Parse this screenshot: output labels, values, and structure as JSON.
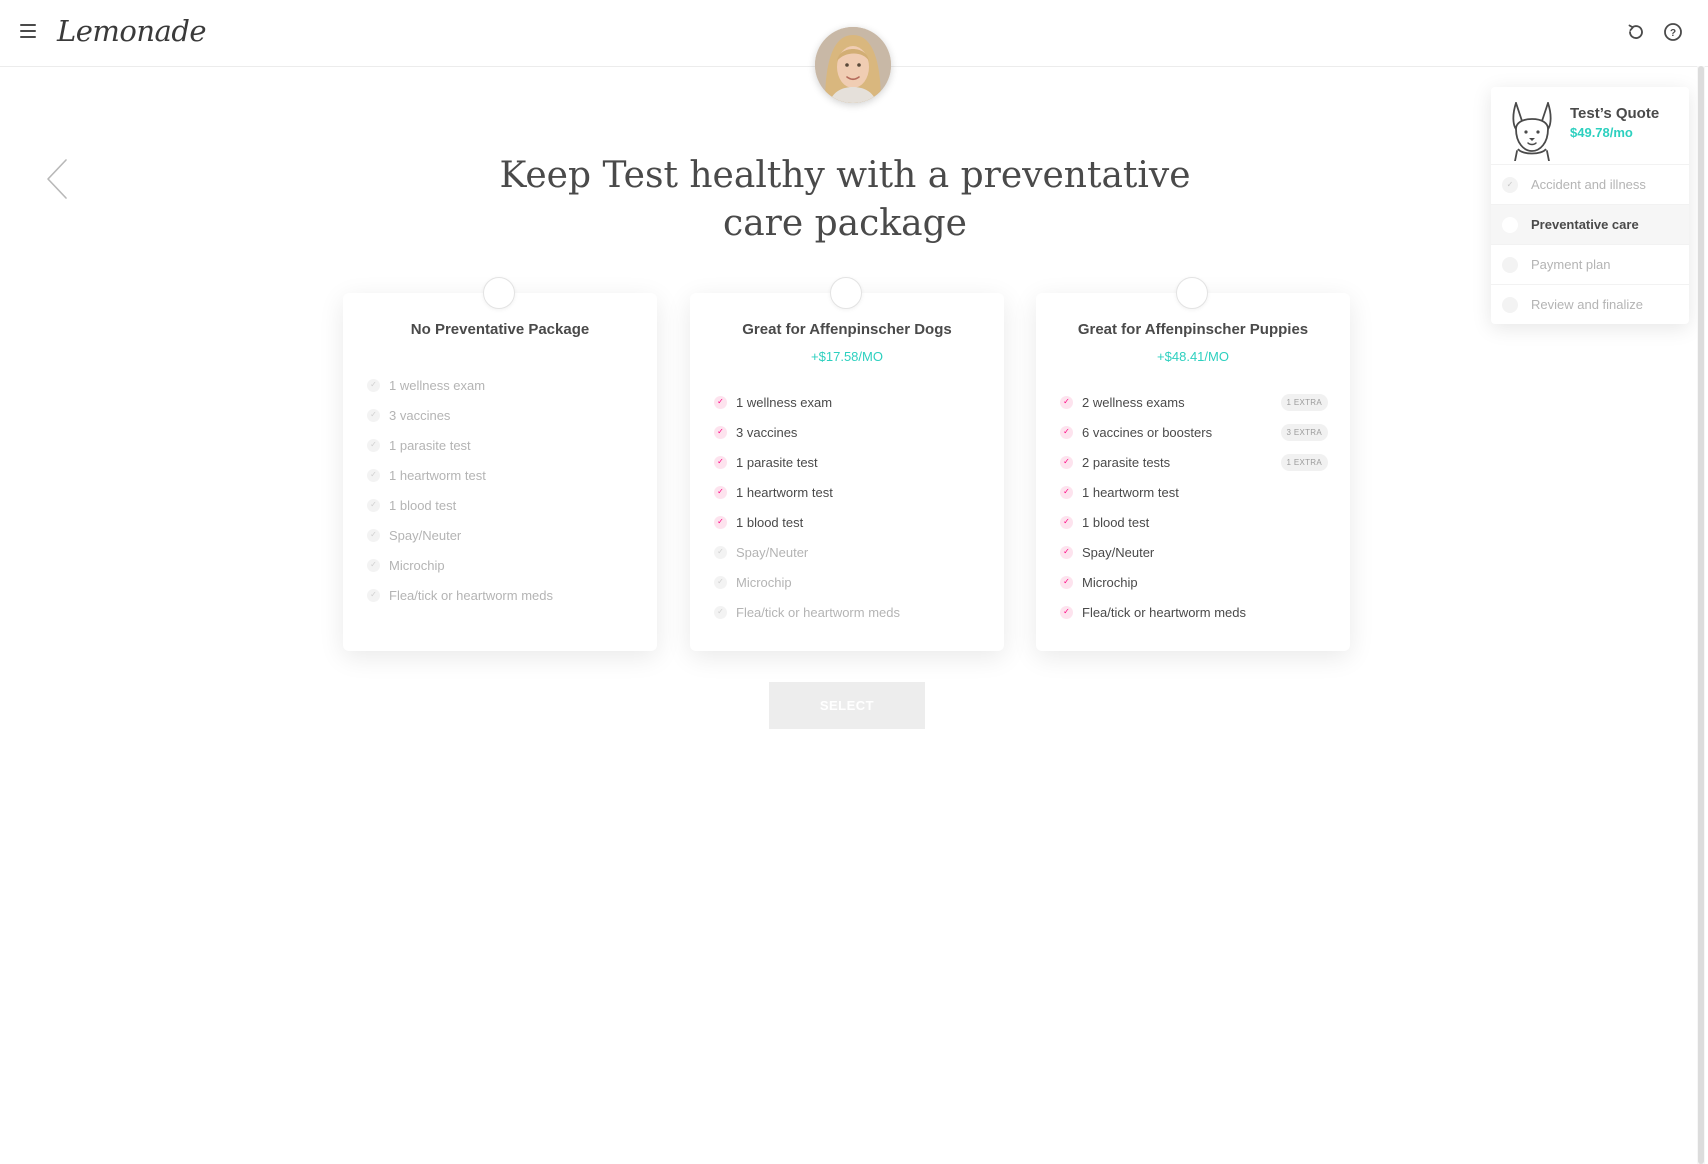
{
  "header": {
    "logo": "Lemonade",
    "menu_icon": "hamburger-icon",
    "refresh_icon": "refresh-icon",
    "help_icon": "help-icon"
  },
  "agent": {
    "avatar_icon": "agent-avatar"
  },
  "nav": {
    "back_icon": "chevron-left-icon"
  },
  "page": {
    "headline_line1": "Keep Test healthy with a preventative",
    "headline_line2": "care package"
  },
  "packages": [
    {
      "title": "No Preventative Package",
      "price": "",
      "items": [
        {
          "label": "1 wellness exam",
          "included": false
        },
        {
          "label": "3 vaccines",
          "included": false
        },
        {
          "label": "1 parasite test",
          "included": false
        },
        {
          "label": "1 heartworm test",
          "included": false
        },
        {
          "label": "1 blood test",
          "included": false
        },
        {
          "label": "Spay/Neuter",
          "included": false
        },
        {
          "label": "Microchip",
          "included": false
        },
        {
          "label": "Flea/tick or heartworm meds",
          "included": false
        }
      ]
    },
    {
      "title": "Great for Affenpinscher Dogs",
      "price": "+$17.58/MO",
      "items": [
        {
          "label": "1 wellness exam",
          "included": true
        },
        {
          "label": "3 vaccines",
          "included": true
        },
        {
          "label": "1 parasite test",
          "included": true
        },
        {
          "label": "1 heartworm test",
          "included": true
        },
        {
          "label": "1 blood test",
          "included": true
        },
        {
          "label": "Spay/Neuter",
          "included": false
        },
        {
          "label": "Microchip",
          "included": false
        },
        {
          "label": "Flea/tick or heartworm meds",
          "included": false
        }
      ]
    },
    {
      "title": "Great for Affenpinscher Puppies",
      "price": "+$48.41/MO",
      "items": [
        {
          "label": "2 wellness exams",
          "included": true,
          "extra": "1 EXTRA"
        },
        {
          "label": "6 vaccines or boosters",
          "included": true,
          "extra": "3 EXTRA"
        },
        {
          "label": "2 parasite tests",
          "included": true,
          "extra": "1 EXTRA"
        },
        {
          "label": "1 heartworm test",
          "included": true
        },
        {
          "label": "1 blood test",
          "included": true
        },
        {
          "label": "Spay/Neuter",
          "included": true
        },
        {
          "label": "Microchip",
          "included": true
        },
        {
          "label": "Flea/tick or heartworm meds",
          "included": true
        }
      ]
    }
  ],
  "select_button": "SELECT",
  "quote": {
    "title": "Test’s Quote",
    "price": "$49.78/mo",
    "pet_icon": "dog-icon",
    "steps": [
      {
        "label": "Accident and illness",
        "state": "done"
      },
      {
        "label": "Preventative care",
        "state": "active"
      },
      {
        "label": "Payment plan",
        "state": "pending"
      },
      {
        "label": "Review and finalize",
        "state": "pending"
      }
    ]
  },
  "colors": {
    "accent_pink": "#ff0083",
    "accent_teal": "#2dd0bf",
    "text": "#4a4a4a",
    "muted": "#b4b4b4"
  }
}
